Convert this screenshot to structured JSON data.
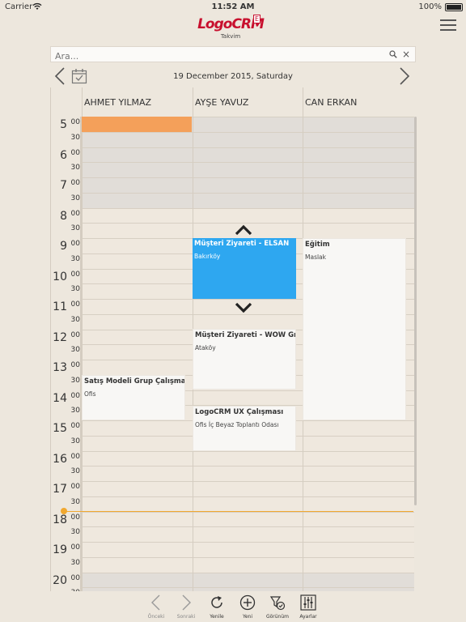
{
  "statusbar": {
    "carrier": "Carrier",
    "time": "11:52 AM",
    "battery": "100%"
  },
  "app": {
    "logo": "LogoCRM",
    "edition": "E",
    "subtitle": "Takvim"
  },
  "search": {
    "placeholder": "Ara..."
  },
  "date_nav": {
    "date": "19 December 2015, Saturday"
  },
  "columns": [
    "AHMET YILMAZ",
    "AYŞE YAVUZ",
    "CAN ERKAN"
  ],
  "hours": [
    "5",
    "6",
    "7",
    "8",
    "9",
    "10",
    "11",
    "12",
    "13",
    "14",
    "15",
    "16",
    "17",
    "18",
    "19",
    "20"
  ],
  "minutes": {
    "full": "00",
    "half": "30"
  },
  "events": [
    {
      "title": "",
      "subtitle": "",
      "color": "orange"
    },
    {
      "title": "Müşteri Ziyareti - ELSAN",
      "subtitle": "Bakırköy",
      "color": "blue"
    },
    {
      "title": "Eğitim",
      "subtitle": "Maslak",
      "color": "white"
    },
    {
      "title": "Müşteri Ziyareti - WOW Grand",
      "subtitle": "Ataköy",
      "color": "white"
    },
    {
      "title": "Satış Modeli Grup Çalışması",
      "subtitle": "Ofis",
      "color": "white"
    },
    {
      "title": "LogoCRM UX Çalışması",
      "subtitle": "Ofis İç Beyaz Toplantı Odası",
      "color": "white"
    }
  ],
  "toolbar": {
    "prev": "Önceki",
    "next": "Sonraki",
    "refresh": "Yenile",
    "new": "Yeni",
    "view": "Görünüm",
    "settings": "Ayarlar"
  },
  "colors": {
    "accent_blue": "#2ea7f0",
    "orange": "#f4a05a",
    "now_line": "#f0a830",
    "brand_red": "#c8102e"
  }
}
